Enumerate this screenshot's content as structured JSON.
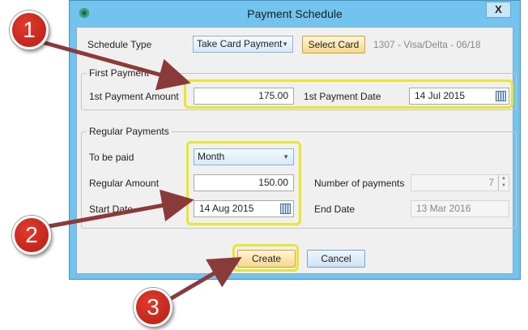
{
  "window": {
    "title": "Payment Schedule",
    "close_glyph": "X"
  },
  "schedule_type": {
    "label": "Schedule Type",
    "value": "Take Card Payment",
    "select_card_label": "Select Card",
    "card_info": "1307 - Visa/Delta - 06/18"
  },
  "first_payment": {
    "group_title": "First Payment",
    "amount_label": "1st Payment Amount",
    "amount_value": "175.00",
    "date_label": "1st Payment Date",
    "date_value": "14 Jul 2015"
  },
  "regular_payments": {
    "group_title": "Regular Payments",
    "to_be_paid_label": "To be paid",
    "to_be_paid_value": "Month",
    "regular_amount_label": "Regular Amount",
    "regular_amount_value": "150.00",
    "number_of_payments_label": "Number of payments",
    "number_of_payments_value": "7",
    "start_date_label": "Start Date",
    "start_date_value": "14 Aug 2015",
    "end_date_label": "End Date",
    "end_date_value": "13 Mar 2016"
  },
  "buttons": {
    "create": "Create",
    "cancel": "Cancel"
  },
  "callouts": [
    {
      "number": "1"
    },
    {
      "number": "2"
    },
    {
      "number": "3"
    }
  ],
  "colors": {
    "highlight": "#e9e62a",
    "arrow": "#8b3a3a",
    "badge": "#d42a20",
    "title_bar": "#72c3ee"
  }
}
